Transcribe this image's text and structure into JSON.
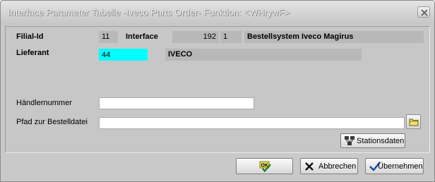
{
  "window": {
    "title": "Interface Parameter Tabelle -Iveco Parts Order- Funktion: <WHrywF>"
  },
  "form": {
    "filial_id_label": "Filial-Id",
    "filial_id_value": "11",
    "interface_label": "Interface",
    "interface_number": "192",
    "interface_index": "1",
    "interface_name": "Bestellsystem Iveco Magirus",
    "lieferant_label": "Lieferant",
    "lieferant_value": "44",
    "lieferant_name": "IVECO",
    "haendlernummer_label": "Händlernummer",
    "haendlernummer_value": "",
    "pfad_label": "Pfad zur Bestelldatei",
    "pfad_value": ""
  },
  "buttons": {
    "stationsdaten": "Stationsdaten",
    "ok": "",
    "abbrechen": "Abbrechen",
    "uebernehmen": "Übernehmen"
  },
  "icons": {
    "close": "close-icon",
    "folder": "folder-icon",
    "stationsdaten": "network-icon",
    "ok": "ok-icon",
    "cancel": "x-icon",
    "apply": "checkmark-icon"
  },
  "colors": {
    "highlight_field": "#00ffff",
    "panel_bg": "#c7c7c7",
    "readonly_field": "#b8b8b8"
  }
}
